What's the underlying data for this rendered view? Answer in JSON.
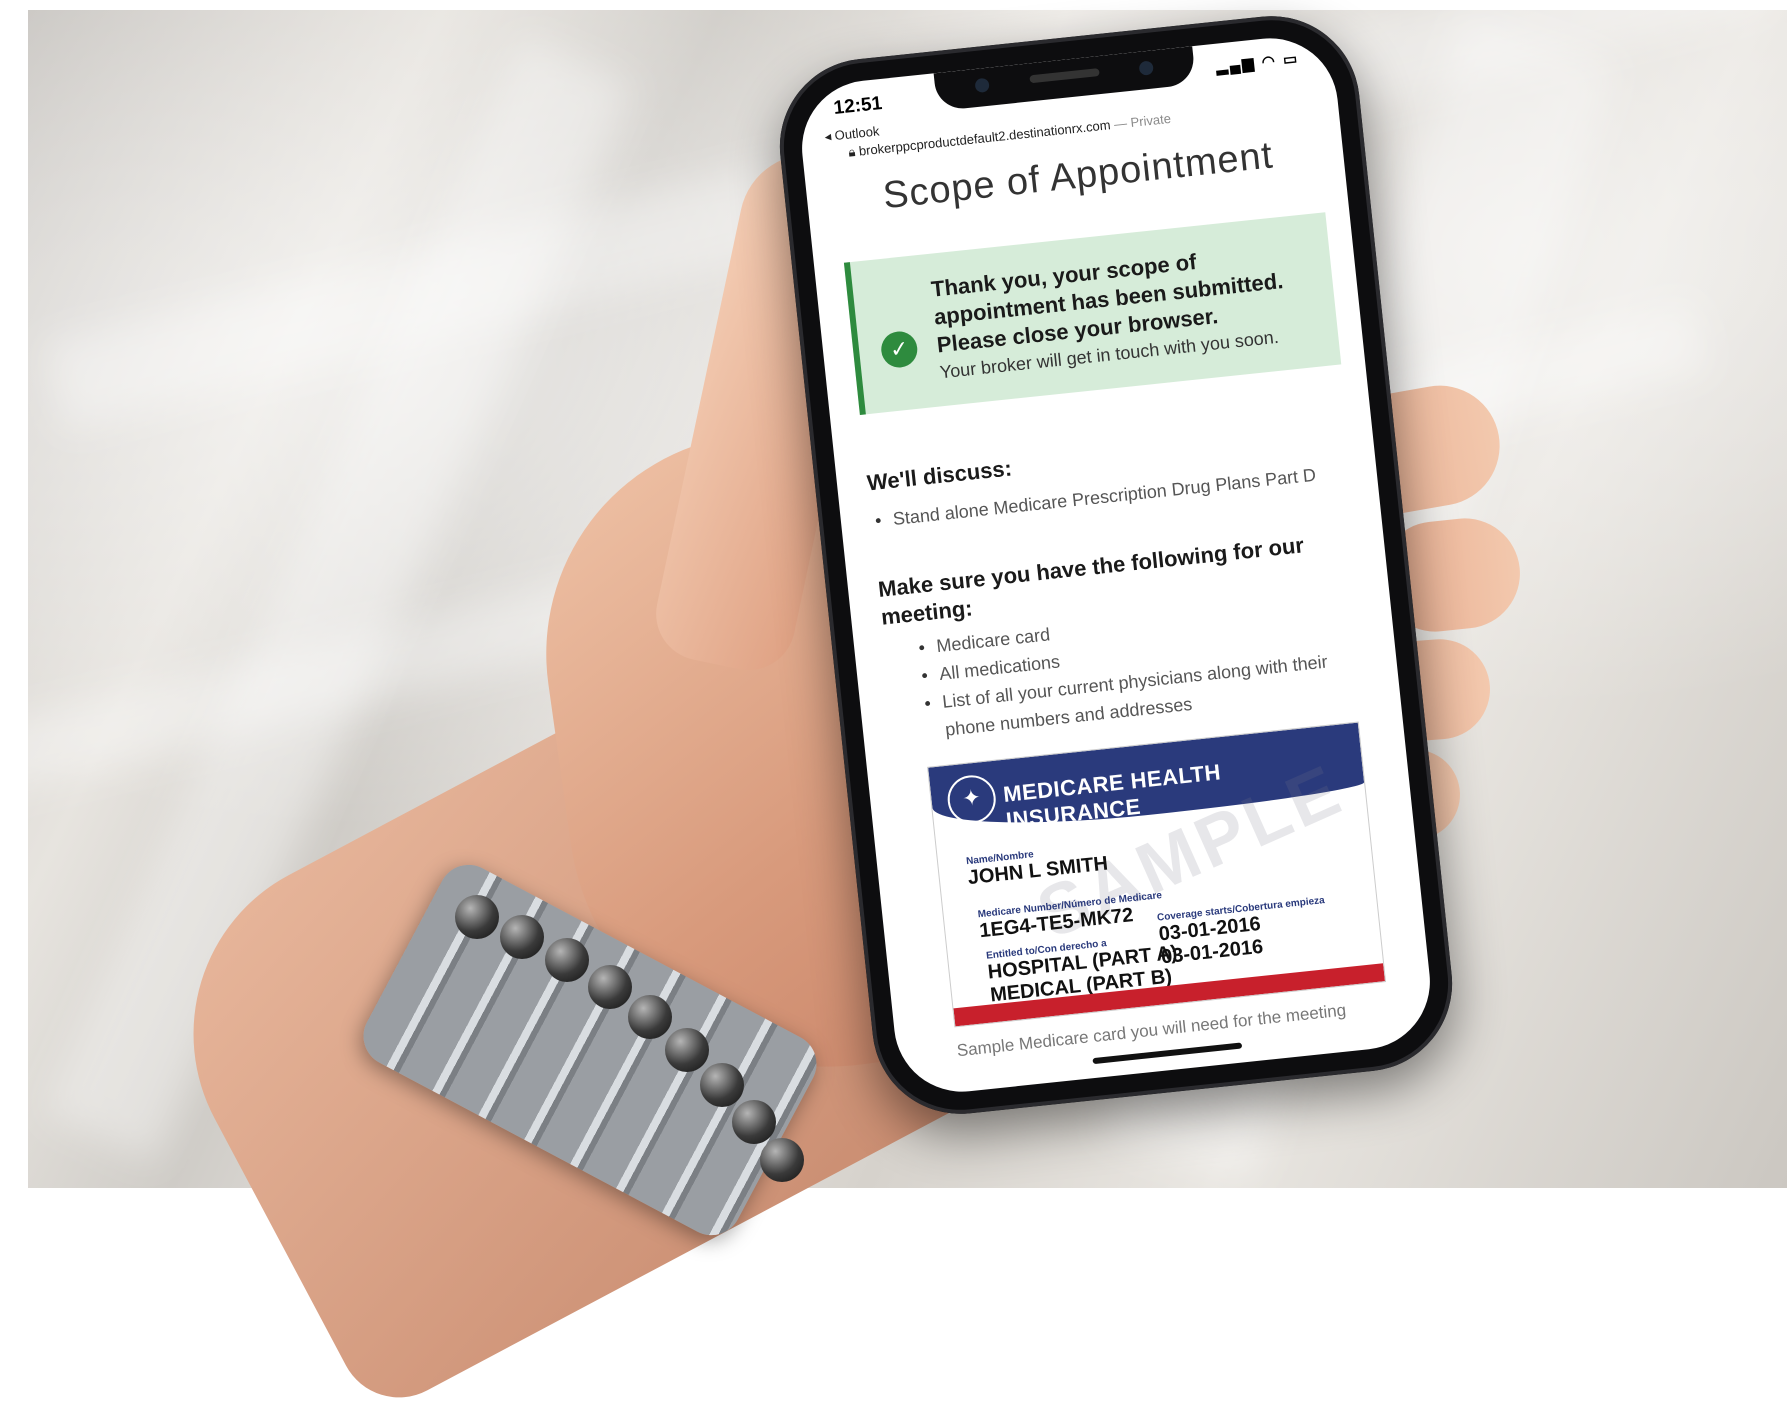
{
  "status_bar": {
    "time": "12:51",
    "signal_icon": "signal-icon",
    "wifi_icon": "wifi-icon",
    "battery_icon": "battery-icon"
  },
  "browser": {
    "back_label": "◂ Outlook",
    "url": "brokerppcproductdefault2.destinationrx.com",
    "private_label": "— Private"
  },
  "page": {
    "title": "Scope of Appointment",
    "alert": {
      "heading": "Thank you, your scope of appointment has been submitted. Please close your browser.",
      "body": "Your broker will get in touch with you soon."
    },
    "discuss": {
      "heading": "We'll discuss:",
      "items": [
        "Stand alone Medicare Prescription Drug Plans Part D"
      ]
    },
    "prepare": {
      "heading": "Make sure you have the following for our meeting:",
      "items": [
        "Medicare card",
        "All medications",
        "List of all your current physicians along with their phone numbers and addresses"
      ]
    },
    "card": {
      "title": "MEDICARE HEALTH INSURANCE",
      "watermark": "SAMPLE",
      "name_label": "Name/Nombre",
      "name": "JOHN L SMITH",
      "number_label": "Medicare Number/Número de Medicare",
      "number": "1EG4-TE5-MK72",
      "entitled_label": "Entitled to/Con derecho a",
      "hospital": "HOSPITAL  (PART A)",
      "medical": "MEDICAL  (PART B)",
      "coverage_label": "Coverage starts/Cobertura empieza",
      "hospital_date": "03-01-2016",
      "medical_date": "03-01-2016"
    },
    "caption": "Sample Medicare card you will need for the meeting"
  },
  "colors": {
    "alert_bg": "#d6ecd9",
    "alert_accent": "#2e8b3e",
    "card_blue": "#2a3a7c",
    "card_red": "#c8202c"
  }
}
